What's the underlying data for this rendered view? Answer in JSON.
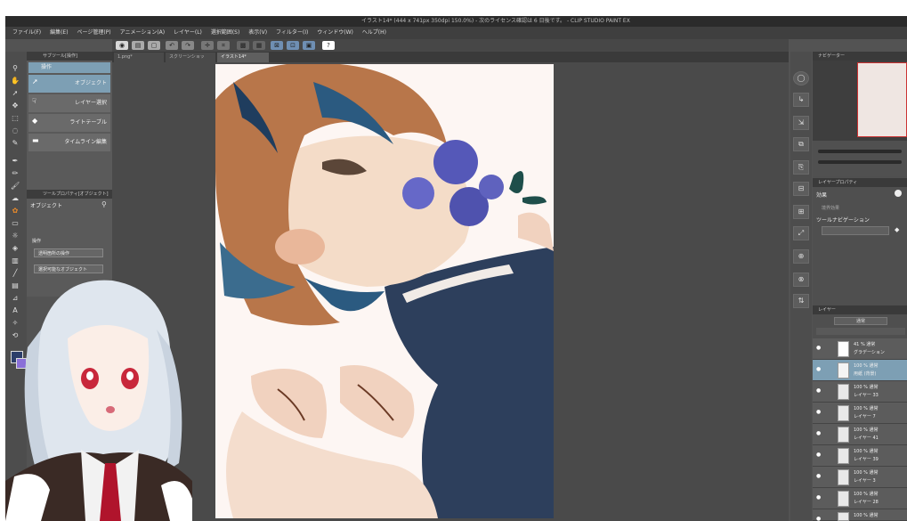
{
  "window": {
    "title": "イラスト14* (444 x 741px 350dpi 150.0%)  - 次のライセンス確認は 6 日後です。 - CLIP STUDIO PAINT EX"
  },
  "menu": [
    "ファイル(F)",
    "編集(E)",
    "ページ管理(P)",
    "アニメーション(A)",
    "レイヤー(L)",
    "選択範囲(S)",
    "表示(V)",
    "フィルター(I)",
    "ウィンドウ(W)",
    "ヘルプ(H)"
  ],
  "tabs": [
    {
      "label": "1.png*"
    },
    {
      "label": "スクリーンショット.png"
    },
    {
      "label": "イラスト14*"
    }
  ],
  "sub_tool": {
    "header": "サブツール[操作]",
    "group": "操作",
    "items": [
      "オブジェクト",
      "レイヤー選択",
      "ライトテーブル",
      "タイムライン編集"
    ]
  },
  "tool_property": {
    "header": "ツールプロパティ[オブジェクト]",
    "name": "オブジェクト",
    "section": "操作",
    "opt1": "透明箇所の操作",
    "opt2": "選択可能なオブジェクト"
  },
  "navigator": {
    "header": "ナビゲーター"
  },
  "layer_property": {
    "header": "レイヤープロパティ",
    "effect": "効果",
    "tool_nav": "ツールナビゲーション",
    "opacity_label": "境界効果"
  },
  "layers": {
    "header": "レイヤー",
    "blend": "通常",
    "rows": [
      {
        "l1": "41 % 通常",
        "l2": "グラデーション"
      },
      {
        "l1": "100 % 通常",
        "l2": "用紙 (背景)"
      },
      {
        "l1": "100 % 通常",
        "l2": "レイヤー 33"
      },
      {
        "l1": "100 % 通常",
        "l2": "レイヤー 7"
      },
      {
        "l1": "100 % 通常",
        "l2": "レイヤー 41"
      },
      {
        "l1": "100 % 通常",
        "l2": "レイヤー 39"
      },
      {
        "l1": "100 % 通常",
        "l2": "レイヤー 3"
      },
      {
        "l1": "100 % 通常",
        "l2": "レイヤー 28"
      },
      {
        "l1": "100 % 通常",
        "l2": "レイヤー 37"
      }
    ]
  },
  "colors": {
    "accent": "#7d9fb4",
    "ui_bg": "#535353",
    "canvas_bg": "#fdf6f3",
    "hair_brown": "#b8764a",
    "jacket": "#2d3f5c"
  }
}
